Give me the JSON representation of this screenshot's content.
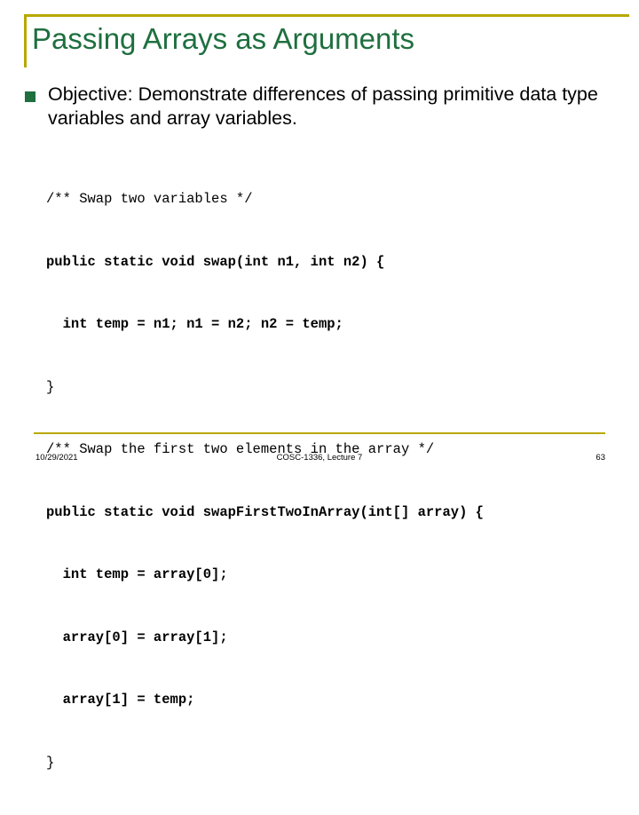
{
  "slide": {
    "title": "Passing Arrays as Arguments",
    "bullet": {
      "marker": "square-bullet",
      "text": "Objective: Demonstrate differences of passing primitive data type variables and array variables."
    },
    "code_lines": [
      "/** Swap two variables */",
      "public static void swap(int n1, int n2) {",
      "  int temp = n1; n1 = n2; n2 = temp;",
      "}",
      "/** Swap the first two elements in the array */",
      "public static void swapFirstTwoInArray(int[] array) {",
      "  int temp = array[0];",
      "  array[0] = array[1];",
      "  array[1] = temp;",
      "}"
    ],
    "footer": {
      "date": "10/29/2021",
      "center": "COSC-1336, Lecture 7",
      "page": "63"
    },
    "colors": {
      "title": "#1f6f3f",
      "rule": "#b8a800",
      "bullet": "#1f6f3f",
      "text": "#000000"
    }
  }
}
